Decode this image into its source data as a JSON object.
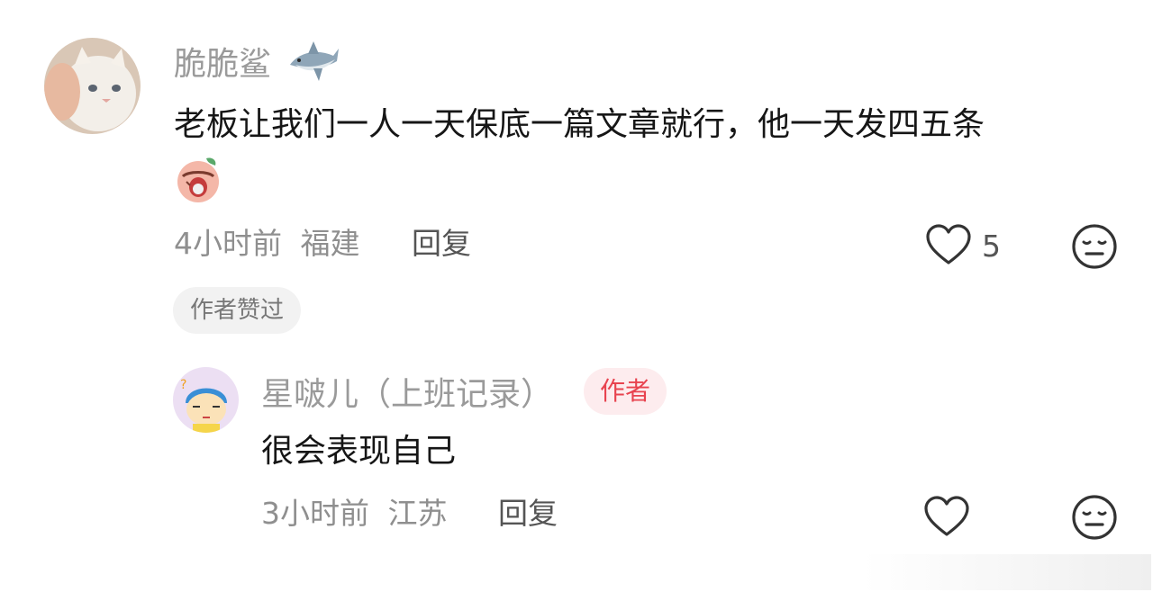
{
  "comment": {
    "username": "脆脆鲨",
    "username_emoji": "shark-emoji",
    "text": "老板让我们一人一天保底一篇文章就行，他一天发四五条",
    "sticker": "crying-face-sticker",
    "time": "4小时前",
    "location": "福建",
    "reply_label": "回复",
    "like_count": "5",
    "liked_by_author_label": "作者赞过"
  },
  "reply": {
    "username": "星啵儿（上班记录）",
    "author_tag": "作者",
    "text": "很会表现自己",
    "time": "3小时前",
    "location": "江苏",
    "reply_label": "回复"
  },
  "icons": {
    "like": "heart-outline-icon",
    "dislike": "meh-face-icon"
  },
  "colors": {
    "author_tag_text": "#e8434f",
    "author_tag_bg": "#fdecee",
    "meta_text": "#8f8f8f",
    "username_text": "#9a9a9a"
  }
}
